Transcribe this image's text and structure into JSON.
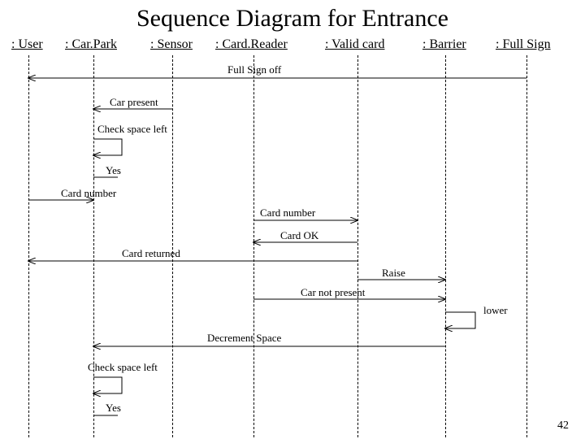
{
  "title": "Sequence Diagram for Entrance",
  "slide_number": "42",
  "participants": {
    "user": ": User",
    "carpark": ": Car.Park",
    "sensor": ": Sensor",
    "cardreader": ": Card.Reader",
    "validcard": ": Valid card",
    "barrier": ": Barrier",
    "fullsign": ": Full Sign"
  },
  "messages": {
    "full_sign_off": "Full Sign off",
    "car_present": "Car present",
    "check_space_left_1": "Check space left",
    "yes_1": "Yes",
    "card_number_1": "Card number",
    "card_number_2": "Card number",
    "card_ok": "Card OK",
    "card_returned": "Card returned",
    "raise": "Raise",
    "car_not_present": "Car not present",
    "lower": "lower",
    "decrement_space": "Decrement Space",
    "check_space_left_2": "Check space left",
    "yes_2": "Yes"
  }
}
